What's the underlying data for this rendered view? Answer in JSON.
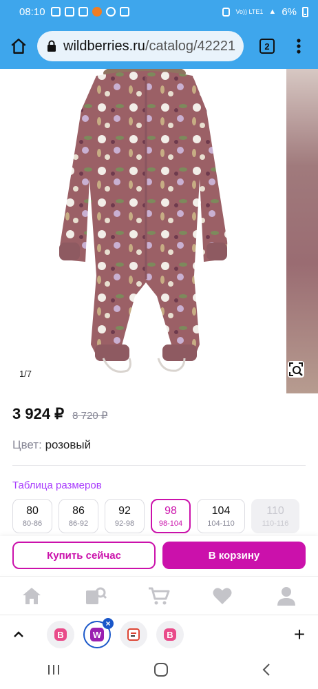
{
  "status": {
    "time": "08:10",
    "network": "Vo)) LTE1",
    "battery": "6%"
  },
  "browser": {
    "url_domain": "wildberries.ru",
    "url_path": "/catalog/42221",
    "tab_count": "2"
  },
  "gallery": {
    "counter": "1/7"
  },
  "product": {
    "price": "3 924 ₽",
    "old_price": "8 720 ₽",
    "color_label": "Цвет:",
    "color_value": "розовый"
  },
  "sizes": {
    "title": "Таблица размеров",
    "items": [
      {
        "size": "80",
        "range": "80-86"
      },
      {
        "size": "86",
        "range": "86-92"
      },
      {
        "size": "92",
        "range": "92-98"
      },
      {
        "size": "98",
        "range": "98-104"
      },
      {
        "size": "104",
        "range": "104-110"
      },
      {
        "size": "110",
        "range": "110-116"
      }
    ],
    "selected": "98",
    "unavailable": "110"
  },
  "actions": {
    "buy_now": "Купить сейчас",
    "add_to_cart": "В корзину"
  },
  "site_nav": {
    "icons": [
      "home-icon",
      "catalog-search-icon",
      "cart-icon",
      "favorites-heart-icon",
      "profile-icon"
    ]
  },
  "tabstrip": {
    "tabs": [
      "wildberries-tab",
      "wildberries-active-tab",
      "tab-3",
      "wildberries-tab-4"
    ],
    "close": "×",
    "new_tab": "+"
  },
  "colors": {
    "brand": "#cb11ab",
    "size_title": "#a73afd",
    "browser_bar": "#3ea6ec"
  }
}
